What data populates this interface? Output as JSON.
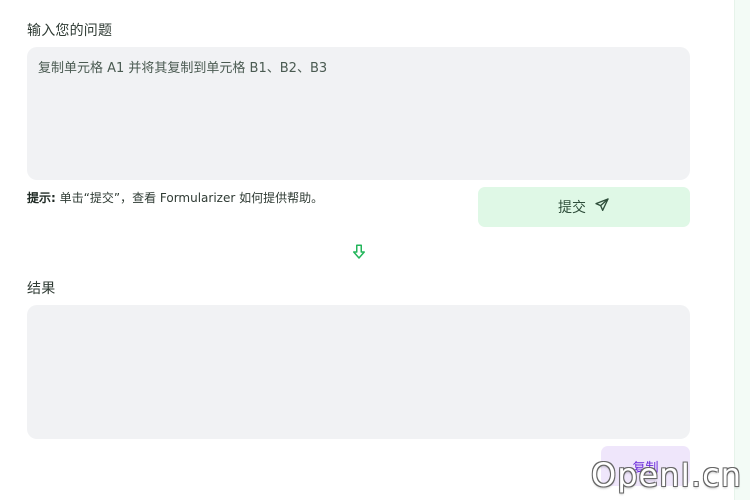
{
  "question": {
    "label": "输入您的问题",
    "text": "复制单元格 A1 并将其复制到单元格 B1、B2、B3"
  },
  "hint": {
    "title": "提示:",
    "text": "单击“提交”，查看 Formularizer 如何提供帮助。"
  },
  "submit_button": {
    "label": "提交",
    "icon": "paper-plane-icon"
  },
  "divider_icon": "arrow-down-icon",
  "result": {
    "label": "结果",
    "text": ""
  },
  "copy_button": {
    "label": "复制"
  },
  "watermark": "OpenI.cn",
  "colors": {
    "submit_bg": "#dff8e6",
    "copy_bg": "#efe6fb",
    "copy_text": "#6b2bd9",
    "accent_green": "#22b55a",
    "field_bg": "#f1f2f4"
  }
}
